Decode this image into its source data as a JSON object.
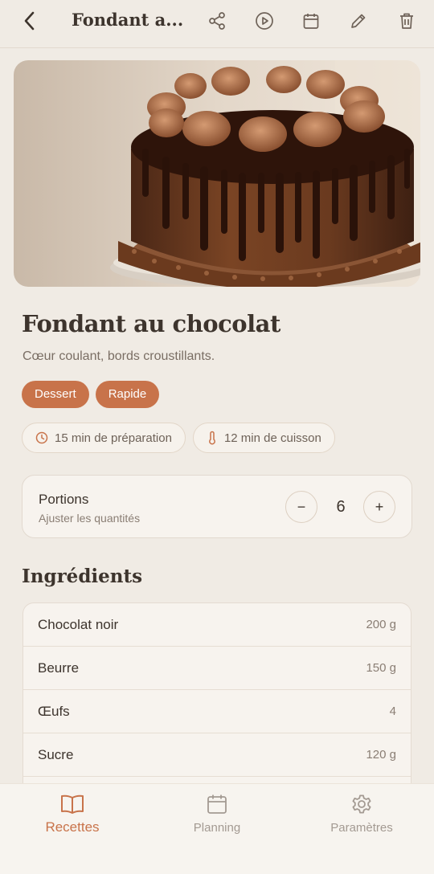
{
  "header": {
    "title": "Fondant a...",
    "icons": [
      "back-icon",
      "share-icon",
      "play-icon",
      "calendar-icon",
      "edit-icon",
      "trash-icon"
    ]
  },
  "recipe": {
    "title": "Fondant au chocolat",
    "subtitle": "Cœur coulant, bords croustillants.",
    "tags": [
      "Dessert",
      "Rapide"
    ],
    "prep_time": "15 min de préparation",
    "cook_time": "12 min de cuisson"
  },
  "portions": {
    "label": "Portions",
    "sublabel": "Ajuster les quantités",
    "decrement": "−",
    "increment": "+",
    "count": "6"
  },
  "ingredients": {
    "title": "Ingrédients",
    "items": [
      {
        "name": "Chocolat noir",
        "qty": "200 g"
      },
      {
        "name": "Beurre",
        "qty": "150 g"
      },
      {
        "name": "Œufs",
        "qty": "4"
      },
      {
        "name": "Sucre",
        "qty": "120 g"
      }
    ]
  },
  "nav": {
    "items": [
      {
        "label": "Recettes",
        "icon": "book-icon",
        "active": true
      },
      {
        "label": "Planning",
        "icon": "calendar-icon",
        "active": false
      },
      {
        "label": "Paramètres",
        "icon": "gear-icon",
        "active": false
      }
    ]
  },
  "colors": {
    "accent": "#c8734a",
    "background": "#f0ebe4",
    "text": "#3d342d"
  }
}
